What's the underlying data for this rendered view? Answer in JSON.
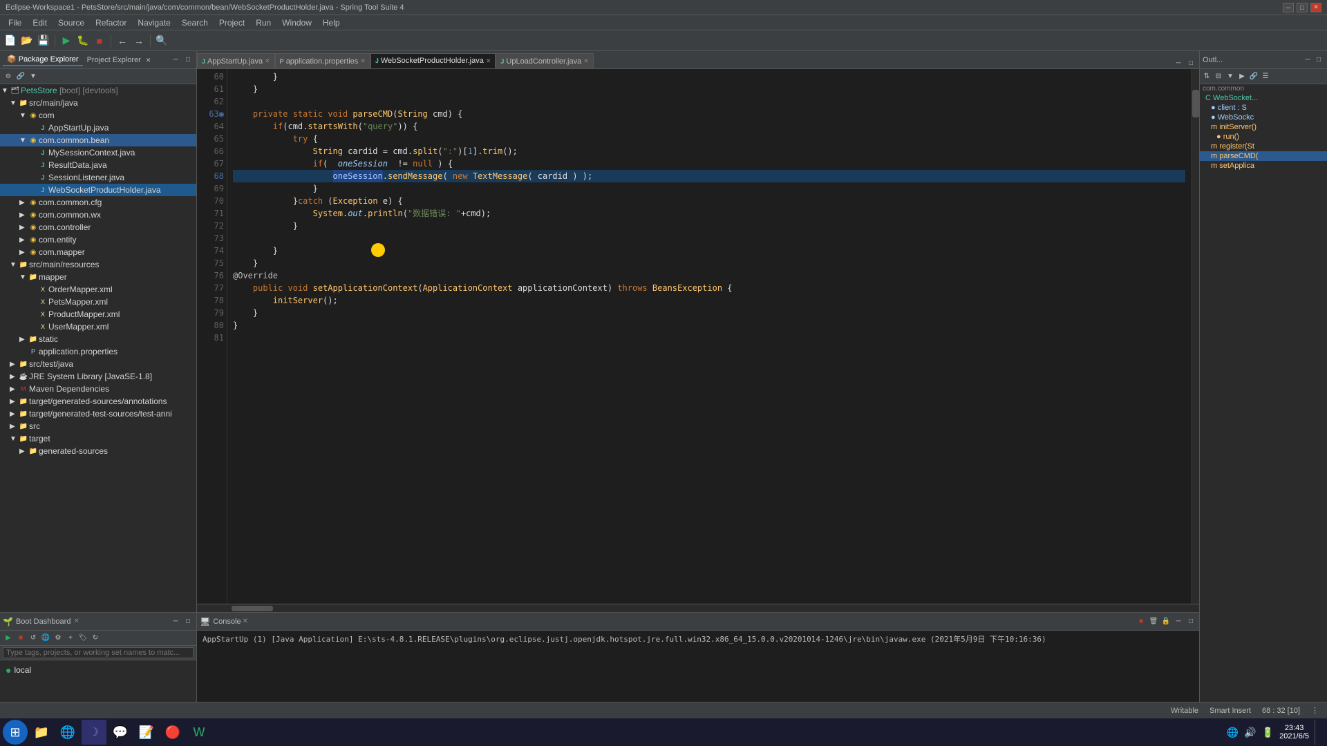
{
  "titlebar": {
    "title": "Eclipse-Workspace1 - PetsStore/src/main/java/com/common/bean/WebSocketProductHolder.java - Spring Tool Suite 4",
    "minimize": "─",
    "maximize": "□",
    "close": "✕"
  },
  "menubar": {
    "items": [
      "File",
      "Edit",
      "Source",
      "Refactor",
      "Navigate",
      "Search",
      "Project",
      "Run",
      "Window",
      "Help"
    ]
  },
  "tabs": {
    "items": [
      {
        "label": "AppStartUp.java",
        "active": false,
        "icon": "J"
      },
      {
        "label": "application.properties",
        "active": false,
        "icon": "P"
      },
      {
        "label": "WebSocketProductHolder.java",
        "active": true,
        "icon": "J"
      },
      {
        "label": "UpLoadController.java",
        "active": false,
        "icon": "J"
      }
    ]
  },
  "editor": {
    "lines": [
      {
        "num": 60,
        "code": "        }",
        "type": "normal"
      },
      {
        "num": 61,
        "code": "    }",
        "type": "normal"
      },
      {
        "num": 62,
        "code": "",
        "type": "normal"
      },
      {
        "num": 63,
        "code": "    private static void parseCMD(String cmd) {",
        "type": "normal"
      },
      {
        "num": 64,
        "code": "        if(cmd.startsWith(\"query\")) {",
        "type": "normal"
      },
      {
        "num": 65,
        "code": "            try {",
        "type": "normal"
      },
      {
        "num": 66,
        "code": "                String cardid = cmd.split(\":\")[1].trim();",
        "type": "normal"
      },
      {
        "num": 67,
        "code": "                if(  oneSession  != null ) {",
        "type": "normal"
      },
      {
        "num": 68,
        "code": "                    oneSession.sendMessage( new TextMessage( cardid ) );",
        "type": "active"
      },
      {
        "num": 69,
        "code": "                }",
        "type": "normal"
      },
      {
        "num": 70,
        "code": "            }catch (Exception e) {",
        "type": "normal"
      },
      {
        "num": 71,
        "code": "                System.out.println(\"数据错误: \"+cmd);",
        "type": "normal"
      },
      {
        "num": 72,
        "code": "            }",
        "type": "normal"
      },
      {
        "num": 73,
        "code": "",
        "type": "normal"
      },
      {
        "num": 74,
        "code": "        }",
        "type": "normal"
      },
      {
        "num": 75,
        "code": "    }",
        "type": "normal"
      },
      {
        "num": 76,
        "code": "@Override",
        "type": "normal"
      },
      {
        "num": 77,
        "code": "    public void setApplicationContext(ApplicationContext applicationContext) throws BeansException {",
        "type": "normal"
      },
      {
        "num": 78,
        "code": "        initServer();",
        "type": "normal"
      },
      {
        "num": 79,
        "code": "    }",
        "type": "normal"
      },
      {
        "num": 80,
        "code": "}",
        "type": "normal"
      },
      {
        "num": 81,
        "code": "",
        "type": "normal"
      }
    ]
  },
  "package_explorer": {
    "title": "Package Explorer",
    "project_tab": "Project Explorer",
    "tree": [
      {
        "indent": 0,
        "label": "PetsStore [boot] [devtools]",
        "icon": "🗂",
        "expanded": true
      },
      {
        "indent": 1,
        "label": "src/main/java",
        "icon": "📁",
        "expanded": true
      },
      {
        "indent": 2,
        "label": "com",
        "icon": "📦",
        "expanded": true
      },
      {
        "indent": 3,
        "label": "AppStartUp.java",
        "icon": "J",
        "color": "#4ec9b0"
      },
      {
        "indent": 2,
        "label": "com.common.bean",
        "icon": "📦",
        "expanded": true,
        "selected": true
      },
      {
        "indent": 3,
        "label": "MySessionContext.java",
        "icon": "J"
      },
      {
        "indent": 3,
        "label": "ResultData.java",
        "icon": "J"
      },
      {
        "indent": 3,
        "label": "SessionListener.java",
        "icon": "J"
      },
      {
        "indent": 3,
        "label": "WebSocketProductHolder.java",
        "icon": "J",
        "active": true
      },
      {
        "indent": 2,
        "label": "com.common.cfg",
        "icon": "📦"
      },
      {
        "indent": 2,
        "label": "com.common.wx",
        "icon": "📦"
      },
      {
        "indent": 2,
        "label": "com.controller",
        "icon": "📦"
      },
      {
        "indent": 2,
        "label": "com.entity",
        "icon": "📦"
      },
      {
        "indent": 2,
        "label": "com.mapper",
        "icon": "📦"
      },
      {
        "indent": 1,
        "label": "src/main/resources",
        "icon": "📁",
        "expanded": true
      },
      {
        "indent": 2,
        "label": "mapper",
        "icon": "📁",
        "expanded": true
      },
      {
        "indent": 3,
        "label": "OrderMapper.xml",
        "icon": "X"
      },
      {
        "indent": 3,
        "label": "PetsMapper.xml",
        "icon": "X"
      },
      {
        "indent": 3,
        "label": "ProductMapper.xml",
        "icon": "X"
      },
      {
        "indent": 3,
        "label": "UserMapper.xml",
        "icon": "X"
      },
      {
        "indent": 2,
        "label": "static",
        "icon": "📁"
      },
      {
        "indent": 2,
        "label": "application.properties",
        "icon": "P"
      },
      {
        "indent": 1,
        "label": "src/test/java",
        "icon": "📁"
      },
      {
        "indent": 1,
        "label": "JRE System Library [JavaSE-1.8]",
        "icon": "☕"
      },
      {
        "indent": 1,
        "label": "Maven Dependencies",
        "icon": "M"
      },
      {
        "indent": 1,
        "label": "target/generated-sources/annotations",
        "icon": "📁"
      },
      {
        "indent": 1,
        "label": "target/generated-test-sources/test-anni",
        "icon": "📁"
      },
      {
        "indent": 1,
        "label": "src",
        "icon": "📁"
      },
      {
        "indent": 1,
        "label": "target",
        "icon": "📁",
        "expanded": true
      },
      {
        "indent": 2,
        "label": "generated-sources",
        "icon": "📁"
      }
    ]
  },
  "outline": {
    "title": "Outl...",
    "items": [
      {
        "label": "com.common",
        "type": "package",
        "indent": 0
      },
      {
        "label": "WebSocket...",
        "type": "class",
        "indent": 1
      },
      {
        "label": "client : S",
        "type": "field",
        "indent": 2
      },
      {
        "label": "WebSockc",
        "type": "field",
        "indent": 2
      },
      {
        "label": "initServer()",
        "type": "method",
        "indent": 2
      },
      {
        "label": "• run()",
        "type": "method",
        "indent": 3
      },
      {
        "label": "register(St",
        "type": "method",
        "indent": 2
      },
      {
        "label": "parseCMD(",
        "type": "method",
        "indent": 2,
        "active": true
      },
      {
        "label": "setApplica",
        "type": "method",
        "indent": 2
      }
    ]
  },
  "console": {
    "title": "Console",
    "content": "AppStartUp (1) [Java Application] E:\\sts-4.8.1.RELEASE\\plugins\\org.eclipse.justj.openjdk.hotspot.jre.full.win32.x86_64_15.0.0.v20201014-1246\\jre\\bin\\javaw.exe  (2021年5月9日 下午10:16:36)"
  },
  "boot_dashboard": {
    "title": "Boot Dashboard",
    "search_placeholder": "Type tags, projects, or working set names to matc...",
    "items": [
      {
        "label": "local",
        "status": "running",
        "color": "#27ae60"
      }
    ]
  },
  "statusbar": {
    "writable": "Writable",
    "smart_insert": "Smart Insert",
    "position": "68 : 32 [10]"
  },
  "taskbar": {
    "time": "23:43",
    "date": "2021/6/5"
  }
}
